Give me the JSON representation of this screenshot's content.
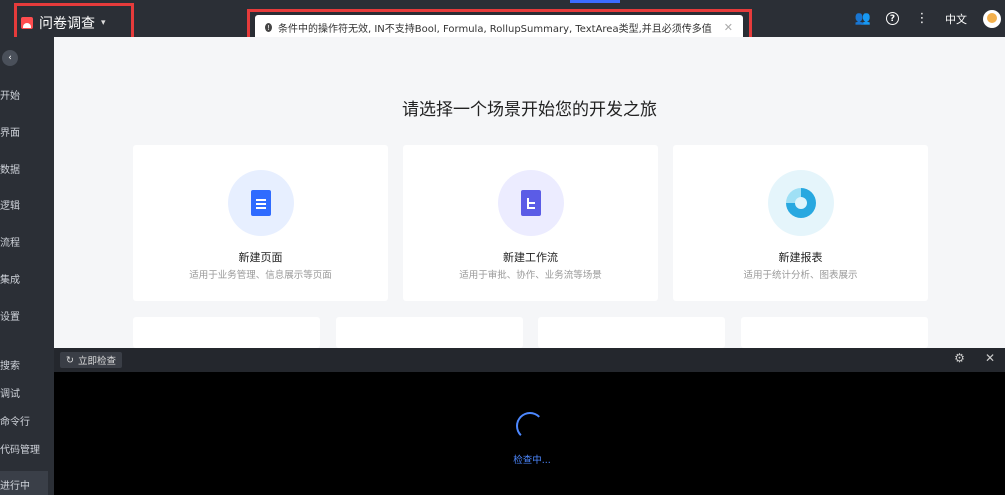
{
  "app": {
    "name": "问卷调查"
  },
  "toast": {
    "message": "条件中的操作符无效, IN不支持Bool, Formula, RollupSummary, TextArea类型,并且必须传多值"
  },
  "topbar": {
    "language": "中文"
  },
  "sidebar": {
    "top_items": [
      "开始",
      "界面",
      "数据",
      "逻辑",
      "流程",
      "集成",
      "设置"
    ],
    "bottom_items": [
      "搜索",
      "调试",
      "命令行",
      "代码管理",
      "进行中"
    ]
  },
  "main": {
    "heading": "请选择一个场景开始您的开发之旅",
    "cards": [
      {
        "title": "新建页面",
        "desc": "适用于业务管理、信息展示等页面",
        "icon": "page-icon"
      },
      {
        "title": "新建工作流",
        "desc": "适用于审批、协作、业务流等场景",
        "icon": "workflow-icon"
      },
      {
        "title": "新建报表",
        "desc": "适用于统计分析、图表展示",
        "icon": "report-icon"
      }
    ]
  },
  "console": {
    "check_label": "立即检查",
    "loading": "检查中..."
  },
  "colors": {
    "accent": "#2f6bff",
    "highlight": "#e63b3b",
    "bg": "#2b2f36"
  }
}
